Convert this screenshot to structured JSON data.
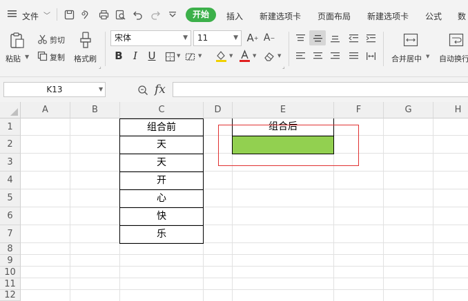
{
  "menu": {
    "file_label": "文件",
    "tabs": [
      "开始",
      "插入",
      "新建选项卡",
      "页面布局",
      "新建选项卡",
      "公式",
      "数"
    ]
  },
  "ribbon": {
    "paste_label": "粘贴",
    "cut_label": "剪切",
    "copy_label": "复制",
    "format_painter_label": "格式刷",
    "font_name": "宋体",
    "font_size": "11",
    "merge_label": "合并居中",
    "wrap_label": "自动换行",
    "bold": "B",
    "italic": "I",
    "underline": "U"
  },
  "formula_bar": {
    "cell_ref": "K13",
    "fx_label": "fx",
    "content": ""
  },
  "sheet": {
    "columns": [
      "A",
      "B",
      "C",
      "D",
      "E",
      "F",
      "G",
      "H"
    ],
    "rows": [
      "1",
      "2",
      "3",
      "4",
      "5",
      "6",
      "7",
      "8",
      "9",
      "10",
      "11",
      "12"
    ],
    "c_header": "组合前",
    "c_values": [
      "天",
      "天",
      "开",
      "心",
      "快",
      "乐"
    ],
    "e_header": "组合后",
    "e2_fill": "#92d050",
    "highlight_color": "#e03030"
  },
  "colors": {
    "accent": "#3cb04a",
    "chrome": "#f3f3f3"
  }
}
